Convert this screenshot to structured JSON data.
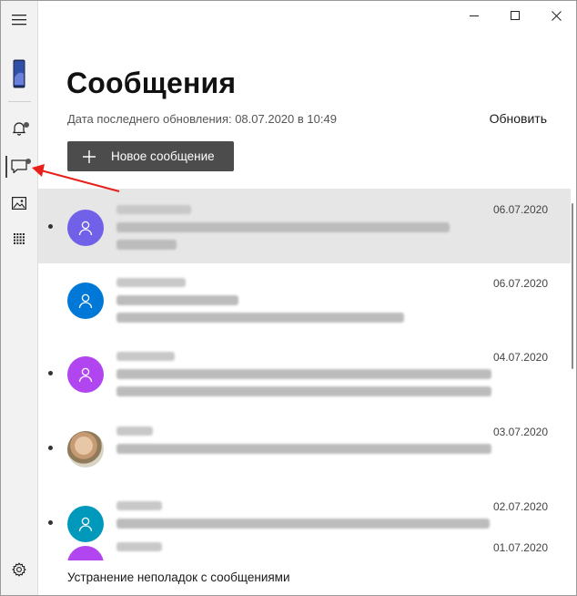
{
  "window": {
    "minimize_icon": "minimize-icon",
    "maximize_icon": "maximize-icon",
    "close_icon": "close-icon"
  },
  "rail": {
    "items": [
      {
        "name": "menu",
        "icon": "hamburger-icon"
      },
      {
        "name": "phone",
        "icon": "phone-icon"
      },
      {
        "name": "notifications",
        "icon": "bell-icon",
        "badge": true
      },
      {
        "name": "messages",
        "icon": "chat-icon",
        "badge": true,
        "active": true
      },
      {
        "name": "photos",
        "icon": "photo-icon"
      },
      {
        "name": "apps",
        "icon": "apps-grid-icon"
      },
      {
        "name": "settings",
        "icon": "gear-icon"
      }
    ]
  },
  "header": {
    "title": "Сообщения",
    "last_update": "Дата последнего обновления: 08.07.2020 в 10:49",
    "refresh_label": "Обновить",
    "new_message_label": "Новое сообщение"
  },
  "conversations": [
    {
      "date": "06.07.2020",
      "unread": true,
      "selected": true,
      "avatar": "purple-person",
      "avatar_color": "#7160e8"
    },
    {
      "date": "06.07.2020",
      "unread": false,
      "selected": false,
      "avatar": "blue-person",
      "avatar_color": "#0078d7"
    },
    {
      "date": "04.07.2020",
      "unread": true,
      "selected": false,
      "avatar": "magenta-person",
      "avatar_color": "#b146f0"
    },
    {
      "date": "03.07.2020",
      "unread": true,
      "selected": false,
      "avatar": "photo"
    },
    {
      "date": "02.07.2020",
      "unread": true,
      "selected": false,
      "avatar": "teal-person",
      "avatar_color": "#0099bc"
    },
    {
      "date": "01.07.2020",
      "unread": false,
      "selected": false,
      "avatar": "magenta-person",
      "avatar_color": "#b146f0"
    }
  ],
  "footer": {
    "troubleshoot_label": "Устранение неполадок с сообщениями"
  },
  "colors": {
    "accent": "#4c4c4c",
    "annotation_arrow": "#e8201c"
  }
}
